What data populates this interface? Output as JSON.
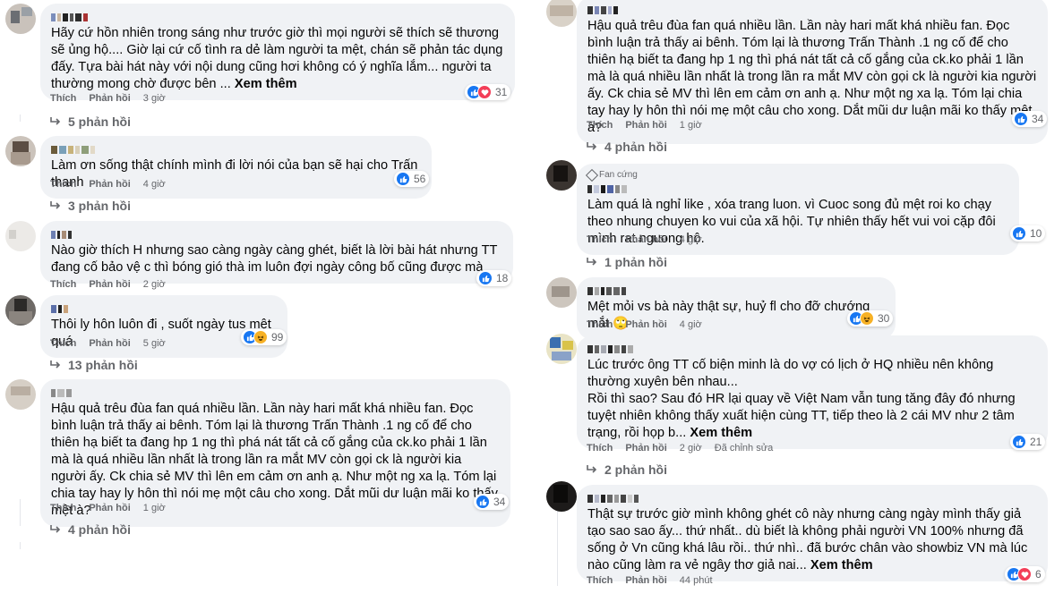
{
  "left": [
    {
      "text": "Hãy cứ hồn nhiên trong sáng như trước giờ thì mọi người sẽ thích sẽ thương sẽ ủng hộ.... Giờ lại cứ cố tình ra dẻ làm người ta mệt, chán sẽ phản tác dụng đấy. Tựa bài hát này với nội dung cũng hơi không có ý nghĩa lắm... người ta thường mong chờ được bên ...",
      "more": "Xem thêm",
      "like": "Thích",
      "reply": "Phản hồi",
      "time": "3 giờ",
      "reactions": [
        "like",
        "love"
      ],
      "count": "31",
      "replies": "5 phản hồi"
    },
    {
      "text": "Làm ơn sống thật chính mình đi lời nói của bạn sẽ hại cho Trấn thanh",
      "like": "Thích",
      "reply": "Phản hồi",
      "time": "4 giờ",
      "reactions": [
        "like"
      ],
      "count": "56",
      "replies": "3 phản hồi"
    },
    {
      "text": "Nào giờ thích H nhưng sao càng ngày càng ghét, biết là lời bài hát nhưng TT đang cố bảo vệ c thì bóng gió thà im luôn đợi ngày công bố cũng được mà",
      "like": "Thích",
      "reply": "Phản hồi",
      "time": "2 giờ",
      "reactions": [
        "like"
      ],
      "count": "18"
    },
    {
      "text": "Thôi ly hôn luôn đi , suốt ngày tus mệt quá",
      "like": "Thích",
      "reply": "Phản hồi",
      "time": "5 giờ",
      "reactions": [
        "like",
        "haha"
      ],
      "count": "99",
      "replies": "13 phản hồi"
    },
    {
      "text": "Hậu quả trêu đùa fan quá nhiều lần. Lần này hari mất khá nhiều fan. Đọc bình luận trả thấy ai bênh. Tóm lại là thương Trấn Thành .1 ng cố để cho thiên hạ biết ta đang hp 1 ng thì phá nát tất cả cố gắng của ck.ko phải 1 lần mà là quá nhiều lần nhất là trong lần ra mắt MV còn gọi ck là người kia người ấy. Ck chia sẻ MV thì lên em cảm ơn anh ạ. Như một ng xa lạ. Tóm lại chia tay hay ly hôn thì nói mẹ một câu cho xong. Dắt mũi dư luận mãi ko thấy mệt à?",
      "like": "Thích",
      "reply": "Phản hồi",
      "time": "1 giờ",
      "reactions": [
        "like"
      ],
      "count": "34",
      "replies": "4 phản hồi"
    }
  ],
  "right": [
    {
      "text": "Hậu quả trêu đùa fan quá nhiều lần. Lần này hari mất khá nhiều fan. Đọc bình luận trả thấy ai bênh. Tóm lại là thương Trấn Thành .1 ng cố để cho thiên hạ biết ta đang hp 1 ng thì phá nát tất cả cố gắng của ck.ko phải 1 lần mà là quá nhiều lần nhất là trong lần ra mắt MV còn gọi ck là người kia người ấy. Ck chia sẻ MV thì lên em cảm ơn anh ạ. Như một ng xa lạ. Tóm lại chia tay hay ly hôn thì nói mẹ một câu cho xong. Dắt mũi dư luận mãi ko thấy mệt à?",
      "like": "Thích",
      "reply": "Phản hồi",
      "time": "1 giờ",
      "reactions": [
        "like"
      ],
      "count": "34",
      "replies": "4 phản hồi"
    },
    {
      "badge": "Fan cứng",
      "text": "Làm quá là nghỉ like , xóa trang luon. vì Cuoc song đủ mệt roi ko chạy theo nhung chuyen ko vui của xã hội. Tự nhiên thấy hết vui voi cặp đôi mình rat nguong hộ.",
      "like": "Thích",
      "reply": "Phản hồi",
      "time": "4 giờ",
      "reactions": [
        "like"
      ],
      "count": "10",
      "replies": "1 phản hồi"
    },
    {
      "text": "Mệt mỏi vs bà này thật sự, huỷ fl cho đỡ chướng mắt 🙄",
      "like": "Thích",
      "reply": "Phản hồi",
      "time": "4 giờ",
      "reactions": [
        "like",
        "haha"
      ],
      "count": "30"
    },
    {
      "text": "Lúc trước ông TT cố biện minh là do vợ có lịch ở HQ nhiều nên không thường xuyên bên nhau...\nRồi thì sao? Sau đó HR lại quay về Việt Nam vẫn tung tăng đây đó nhưng tuyệt nhiên không thấy xuất hiện cùng TT, tiếp theo là 2 cái MV như 2 tâm trạng, rồi họp b...",
      "more": "Xem thêm",
      "like": "Thích",
      "reply": "Phản hồi",
      "time": "2 giờ",
      "edited": "Đã chỉnh sửa",
      "reactions": [
        "like"
      ],
      "count": "21",
      "replies": "2 phản hồi"
    },
    {
      "text": "Thật sự trước giờ mình không ghét cô này nhưng càng ngày mình thấy giả tạo sao sao ấy... thứ nhất.. dù biết là không phải người VN 100% nhưng đã sống ở Vn cũng khá lâu rồi.. thứ nhì.. đã bước chân vào showbiz VN mà lúc nào cũng làm ra vẻ ngây thơ giả nai...",
      "more": "Xem thêm",
      "like": "Thích",
      "reply": "Phản hồi",
      "time": "44 phút",
      "reactions": [
        "like",
        "love"
      ],
      "count": "6"
    }
  ],
  "colors": {
    "like": "#1877f2",
    "love": "#f33e58",
    "haha": "#f7b125",
    "bubble": "#f0f2f5",
    "meta": "#65676b"
  },
  "icons": {
    "reply_arrow": "reply-arrow-icon",
    "like": "like-icon",
    "love": "love-icon",
    "haha": "haha-icon",
    "badge": "fan-badge-icon"
  }
}
